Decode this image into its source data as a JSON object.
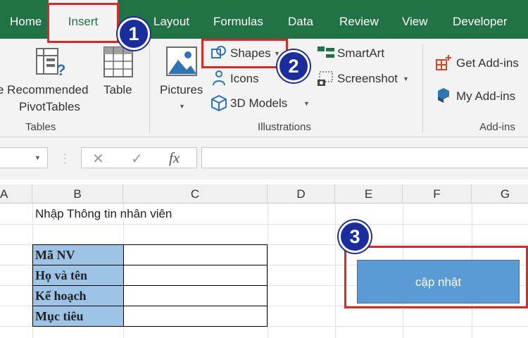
{
  "tabs": [
    "Home",
    "Insert",
    "Layout",
    "Formulas",
    "Data",
    "Review",
    "View",
    "Developer"
  ],
  "active_tab": "Insert",
  "ribbon": {
    "tables": {
      "recommended_line1": "e Recommended",
      "recommended_line2": "PivotTables",
      "table": "Table",
      "group": "Tables"
    },
    "illustrations": {
      "pictures": "Pictures",
      "shapes": "Shapes",
      "icons": "Icons",
      "models": "3D Models",
      "smartart": "SmartArt",
      "screenshot": "Screenshot",
      "group": "Illustrations"
    },
    "addins": {
      "get": "Get Add-ins",
      "my": "My Add-ins",
      "group": "Add-ins"
    }
  },
  "formula_bar": {
    "cancel": "✕",
    "enter": "✓",
    "fx": "fx"
  },
  "columns": [
    "A",
    "B",
    "C",
    "D",
    "E",
    "F",
    "G"
  ],
  "sheet": {
    "heading": "Nhập Thông tin nhân viên",
    "form_labels": [
      "Mã NV",
      "Họ và tên",
      "Kế hoạch",
      "Mục tiêu"
    ],
    "button_label": "cập nhật"
  },
  "badges": [
    "1",
    "2",
    "3"
  ],
  "colors": {
    "excel_green": "#217346",
    "highlight_red": "#d42a2a",
    "badge_blue": "#1b2d9c",
    "button_blue": "#5b9bd5",
    "label_fill": "#9dc3e6"
  }
}
